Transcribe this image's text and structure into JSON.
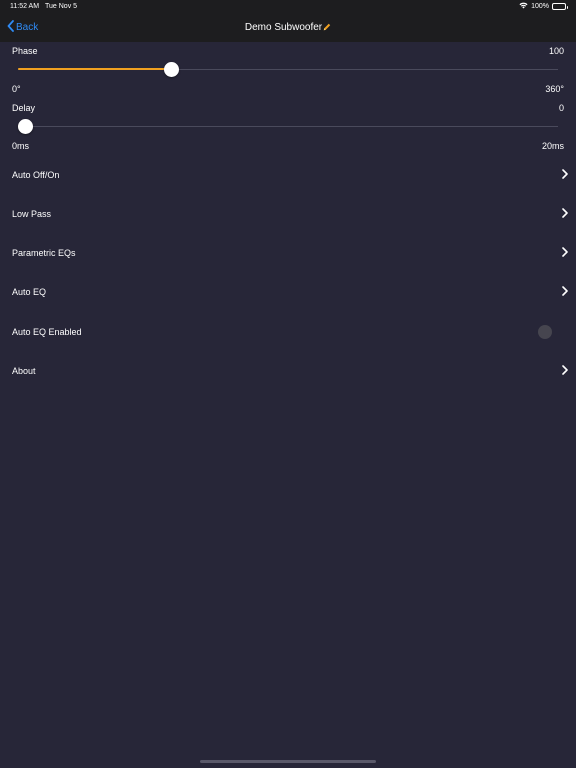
{
  "status_bar": {
    "time": "11:52 AM",
    "date": "Tue Nov 5",
    "battery": "100%",
    "battery_level": 1.0,
    "wifi_icon": "wifi-icon",
    "battery_icon": "battery-icon"
  },
  "nav": {
    "back_label": "Back",
    "title": "Demo Subwoofer",
    "back_icon": "chevron-left-icon",
    "edit_icon": "pencil-icon"
  },
  "phase": {
    "label": "Phase",
    "value": "100",
    "min_label": "0°",
    "max_label": "360°",
    "min": 0,
    "max": 360,
    "current": 100
  },
  "delay": {
    "label": "Delay",
    "value": "0",
    "min_label": "0ms",
    "max_label": "20ms",
    "min": 0,
    "max": 20,
    "current": 0
  },
  "menu": {
    "items": [
      {
        "label": "Auto Off/On",
        "type": "link"
      },
      {
        "label": "Low Pass",
        "type": "link"
      },
      {
        "label": "Parametric EQs",
        "type": "link"
      },
      {
        "label": "Auto EQ",
        "type": "link"
      },
      {
        "label": "Auto EQ Enabled",
        "type": "toggle",
        "on": false
      },
      {
        "label": "About",
        "type": "link"
      }
    ]
  },
  "colors": {
    "background": "#272638",
    "bar": "#1d1d1f",
    "accent": "#2f8bf5",
    "slider_fill": "#f0a020"
  }
}
